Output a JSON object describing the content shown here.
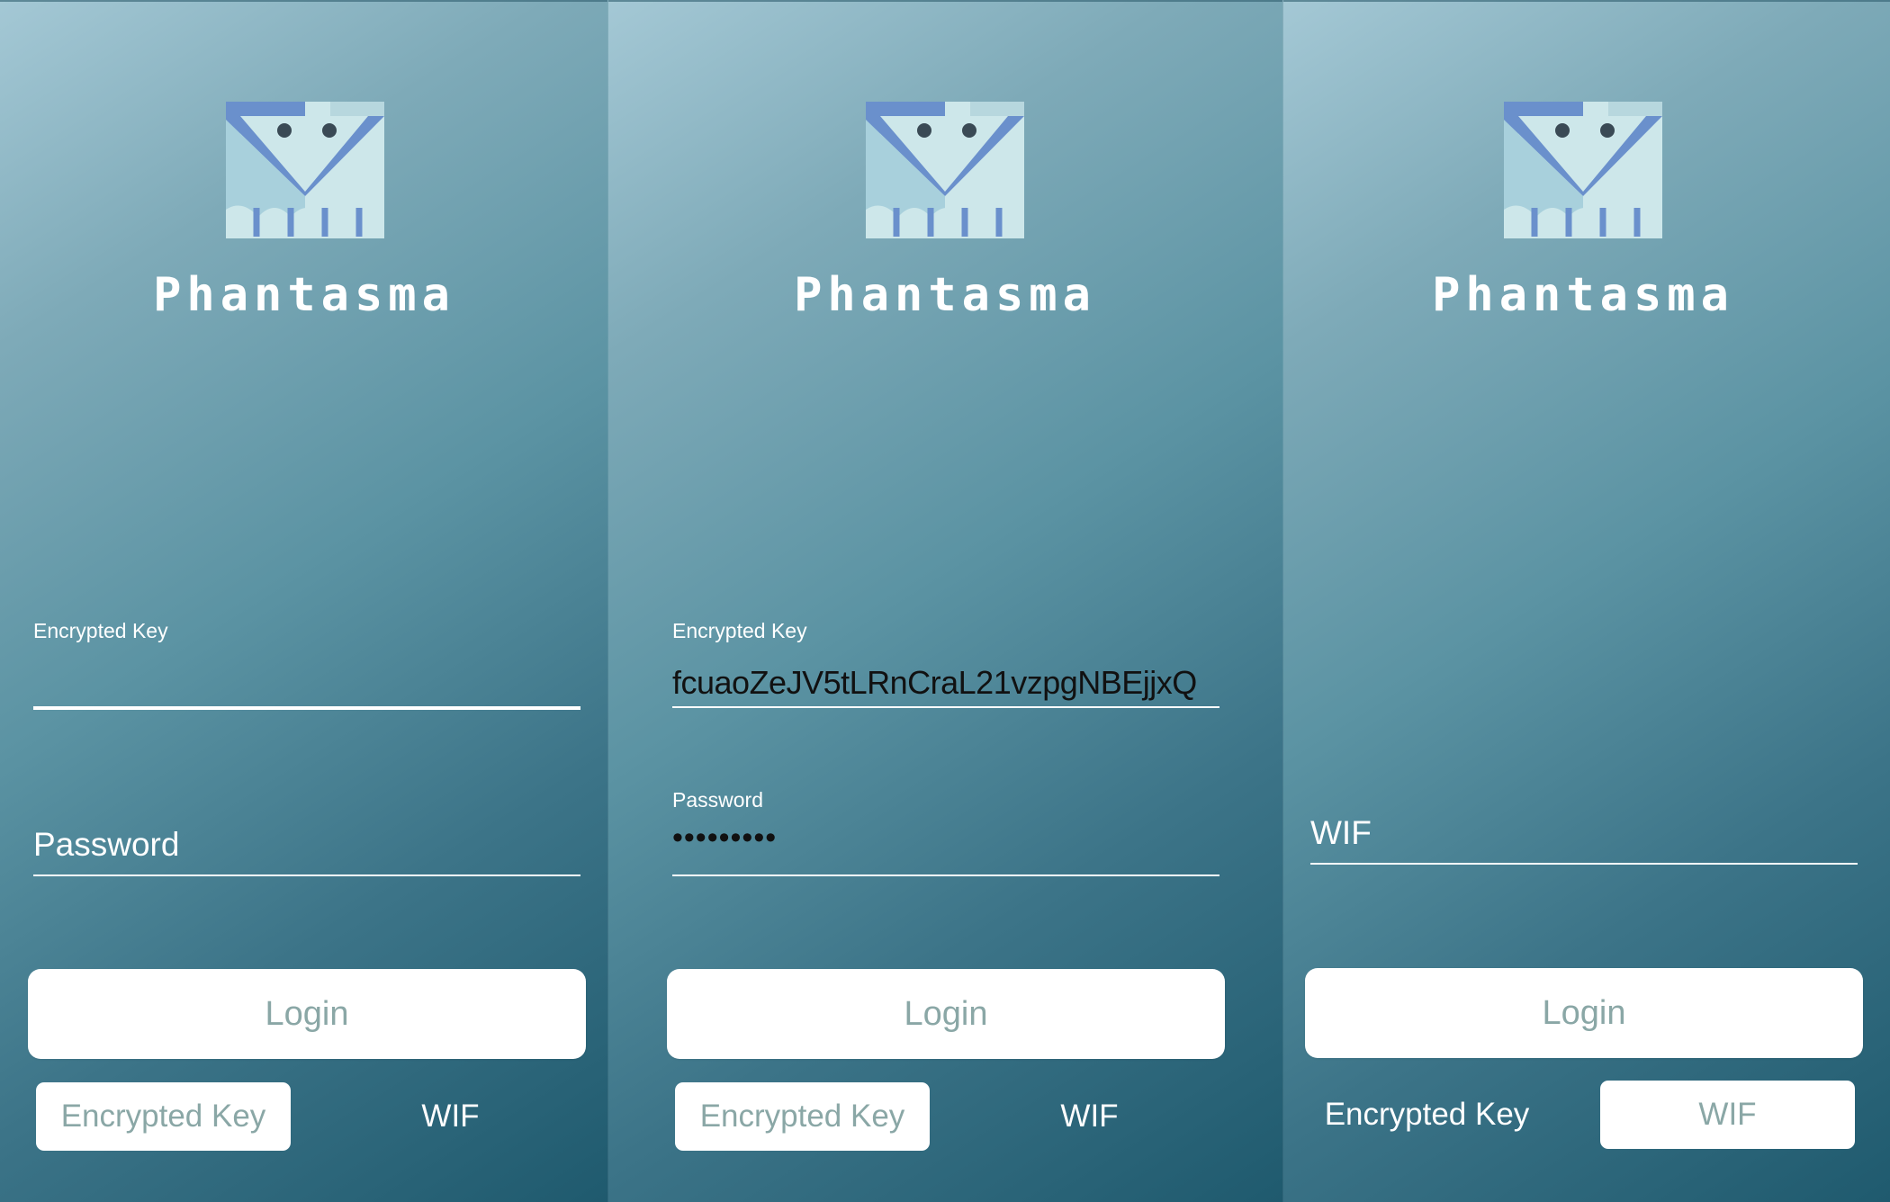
{
  "app": {
    "brand_name": "Phantasma"
  },
  "colors": {
    "button_text": "#8aa7a6",
    "logo_dark": "#6a90cc",
    "logo_light": "#cde7ea"
  },
  "screens": [
    {
      "fields": [
        {
          "label": "Encrypted Key",
          "value": ""
        },
        {
          "placeholder": "Password"
        }
      ],
      "login_label": "Login",
      "toggle": {
        "encrypted_key": "Encrypted Key",
        "wif": "WIF",
        "active": "encrypted_key"
      }
    },
    {
      "fields": [
        {
          "label": "Encrypted Key",
          "value": "fcuaoZeJV5tLRnCraL21vzpgNBEjjxQ"
        },
        {
          "label": "Password",
          "value": "•••••••••"
        }
      ],
      "login_label": "Login",
      "toggle": {
        "encrypted_key": "Encrypted Key",
        "wif": "WIF",
        "active": "encrypted_key"
      }
    },
    {
      "fields": [
        {
          "placeholder": "WIF"
        }
      ],
      "login_label": "Login",
      "toggle": {
        "encrypted_key": "Encrypted Key",
        "wif": "WIF",
        "active": "wif"
      }
    }
  ]
}
